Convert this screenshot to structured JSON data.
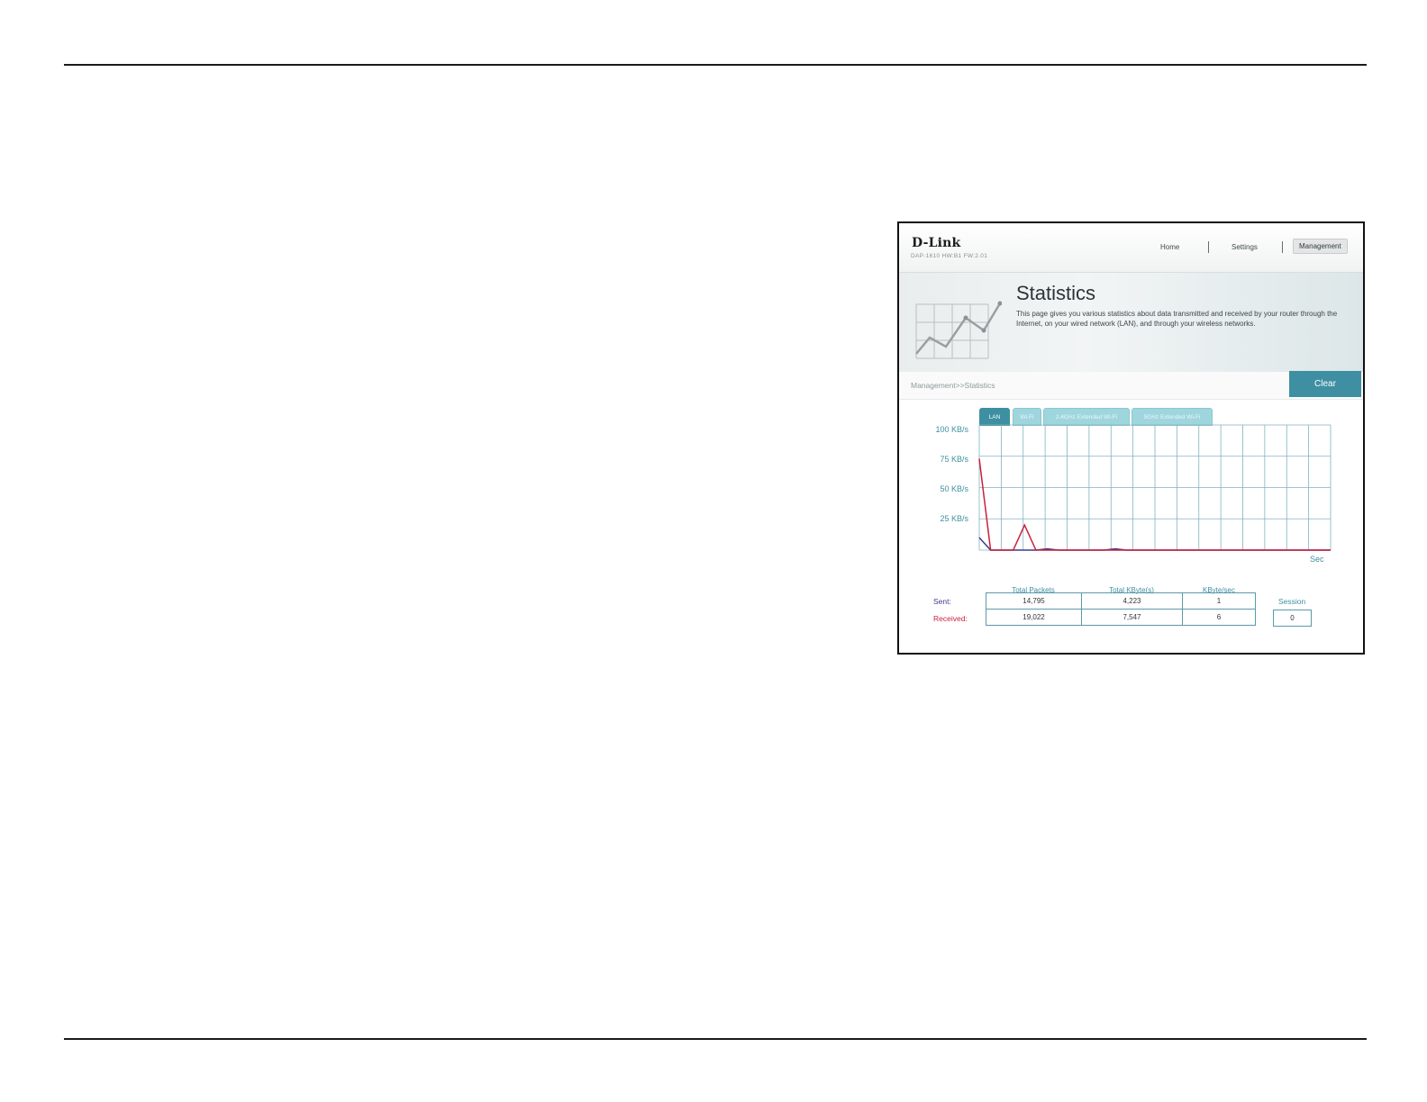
{
  "header": {
    "logo": "D-Link",
    "model": "DAP-1610 HW:B1 FW:2.01",
    "nav": [
      "Home",
      "Settings",
      "Management"
    ],
    "active_nav": "Management"
  },
  "hero": {
    "title": "Statistics",
    "description": "This page gives you various statistics about data transmitted and received by your router through the Internet, on your wired network (LAN), and through your wireless networks."
  },
  "breadcrumb": "Management>>Statistics",
  "clear_label": "Clear",
  "tabs": [
    "LAN",
    "Wi-Fi",
    "2.4GHz Extended Wi-Fi",
    "5GHz Extended Wi-Fi"
  ],
  "active_tab": "LAN",
  "chart_data": {
    "type": "line",
    "y_ticks": [
      "100 KB/s",
      "75 KB/s",
      "50 KB/s",
      "25 KB/s"
    ],
    "xlabel": "Sec",
    "ylim": [
      0,
      100
    ],
    "series": [
      {
        "name": "Sent",
        "color": "#3c3a8c",
        "values": [
          10,
          0,
          0,
          0,
          0,
          0,
          1,
          0,
          0,
          0,
          0,
          0,
          1,
          0,
          0,
          0,
          0,
          0,
          0,
          0,
          0,
          0,
          0,
          0,
          0,
          0,
          0,
          0,
          0,
          0,
          0,
          0
        ]
      },
      {
        "name": "Received",
        "color": "#cc1f3d",
        "values": [
          73,
          0,
          0,
          0,
          20,
          0,
          0,
          0,
          0,
          0,
          0,
          0,
          0,
          0,
          0,
          0,
          0,
          0,
          0,
          0,
          0,
          0,
          0,
          0,
          0,
          0,
          0,
          0,
          0,
          0,
          0,
          0
        ]
      }
    ]
  },
  "stats": {
    "headers": [
      "Total Packets",
      "Total KByte(s)",
      "KByte/sec"
    ],
    "sent_label": "Sent:",
    "received_label": "Received:",
    "sent": [
      "14,795",
      "4,223",
      "1"
    ],
    "received": [
      "19,022",
      "7,547",
      "6"
    ],
    "session_label": "Session",
    "session_value": "0",
    "sent_color": "#3c3a8c",
    "received_color": "#cc1f3d"
  }
}
